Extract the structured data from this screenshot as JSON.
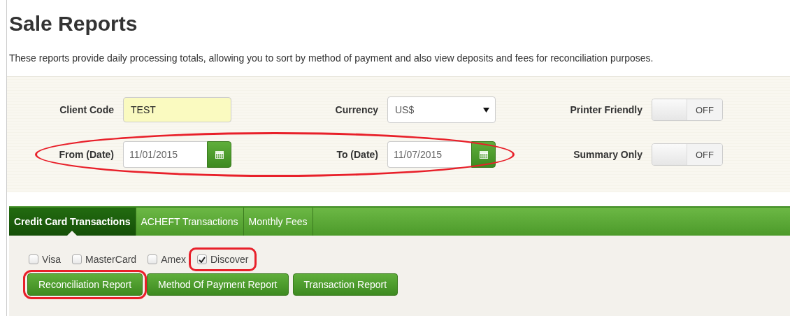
{
  "title": "Sale Reports",
  "description": "These reports provide daily processing totals, allowing you to sort by method of payment and also view deposits and fees for reconciliation purposes.",
  "form": {
    "rows": [
      {
        "annotated": false,
        "fields": [
          {
            "kind": "text",
            "label": "Client Code",
            "value": "TEST"
          },
          {
            "kind": "select",
            "label": "Currency",
            "value": "US$"
          },
          {
            "kind": "toggle",
            "label": "Printer Friendly",
            "on": false,
            "state_text": "OFF"
          }
        ]
      },
      {
        "annotated": true,
        "fields": [
          {
            "kind": "date",
            "label": "From (Date)",
            "value": "11/01/2015"
          },
          {
            "kind": "date",
            "label": "To (Date)",
            "value": "11/07/2015"
          },
          {
            "kind": "toggle",
            "label": "Summary Only",
            "on": false,
            "state_text": "OFF"
          }
        ]
      }
    ]
  },
  "tabs": [
    {
      "label": "Credit Card Transactions",
      "selected": true
    },
    {
      "label": "ACHEFT Transactions",
      "selected": false
    },
    {
      "label": "Monthly Fees",
      "selected": false
    }
  ],
  "checkboxes": [
    {
      "label": "Visa",
      "checked": false,
      "annotated": false
    },
    {
      "label": "MasterCard",
      "checked": false,
      "annotated": false
    },
    {
      "label": "Amex",
      "checked": false,
      "annotated": false
    },
    {
      "label": "Discover",
      "checked": true,
      "annotated": true
    }
  ],
  "buttons": [
    {
      "label": "Reconciliation Report",
      "annotated": true
    },
    {
      "label": "Method Of Payment Report",
      "annotated": false
    },
    {
      "label": "Transaction Report",
      "annotated": false
    }
  ]
}
